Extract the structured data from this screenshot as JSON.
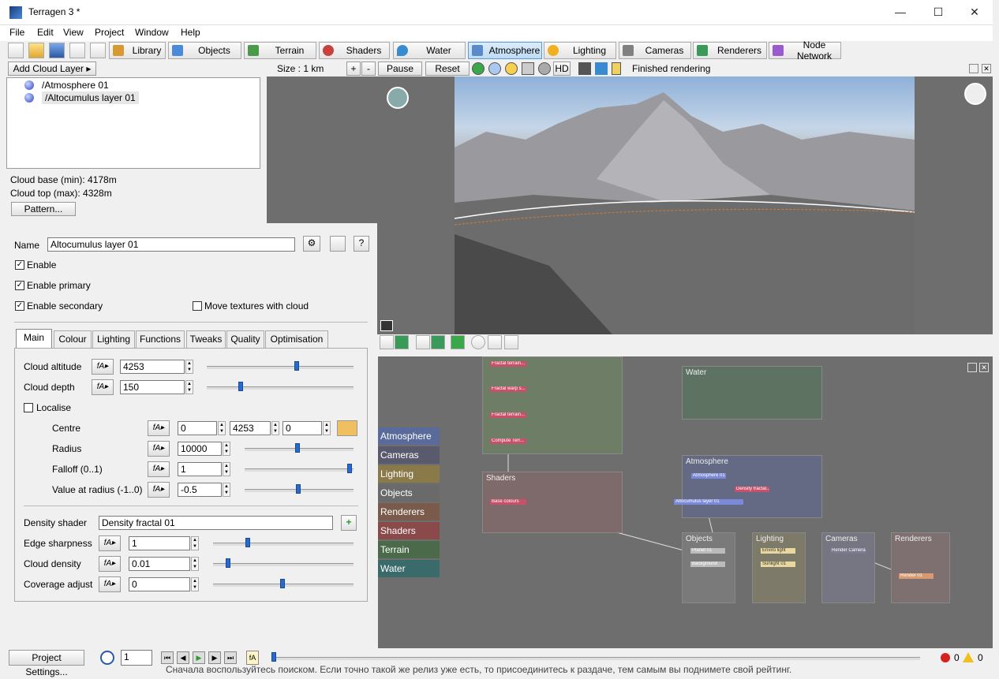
{
  "window": {
    "title": "Terragen 3 *",
    "minimize": "—",
    "maximize": "☐",
    "close": "✕"
  },
  "menu": [
    "File",
    "Edit",
    "View",
    "Project",
    "Window",
    "Help"
  ],
  "toolbar": {
    "tabs": [
      {
        "label": "Library",
        "color": "#d89a30"
      },
      {
        "label": "Objects",
        "color": "#4a8ad8"
      },
      {
        "label": "Terrain",
        "color": "#4a9a4a"
      },
      {
        "label": "Shaders",
        "color": "#c84040"
      },
      {
        "label": "Water",
        "color": "#3a8ad0"
      },
      {
        "label": "Atmosphere",
        "color": "#5a8ac8"
      },
      {
        "label": "Lighting",
        "color": "#f0b020"
      },
      {
        "label": "Cameras",
        "color": "#808080"
      },
      {
        "label": "Renderers",
        "color": "#3a9a5a"
      },
      {
        "label": "Node Network",
        "color": "#9a5ad0"
      }
    ]
  },
  "left_panel": {
    "add_cloud_layer": "Add Cloud Layer",
    "tree": [
      "/Atmosphere 01",
      "/Altocumulus layer 01"
    ],
    "cloud_base": "Cloud base (min): 4178m",
    "cloud_top": "Cloud top (max): 4328m",
    "pattern_button": "Pattern..."
  },
  "viewport_bar": {
    "size": "Size : 1 km",
    "plus": "+",
    "minus": "-",
    "pause": "Pause",
    "reset": "Reset",
    "hd": "HD",
    "status": "Finished rendering"
  },
  "props": {
    "name_label": "Name",
    "name_value": "Altocumulus layer 01",
    "help": "?",
    "enable": "Enable",
    "enable_primary": "Enable primary",
    "enable_secondary": "Enable secondary",
    "move_textures": "Move textures with cloud",
    "tabs": [
      "Main",
      "Colour",
      "Lighting",
      "Functions",
      "Tweaks",
      "Quality",
      "Optimisation"
    ],
    "cloud_altitude": {
      "label": "Cloud altitude",
      "value": "4253"
    },
    "cloud_depth": {
      "label": "Cloud depth",
      "value": "150"
    },
    "localise": "Localise",
    "centre": {
      "label": "Centre",
      "x": "0",
      "y": "4253",
      "z": "0"
    },
    "radius": {
      "label": "Radius",
      "value": "10000"
    },
    "falloff": {
      "label": "Falloff (0..1)",
      "value": "1"
    },
    "value_at_radius": {
      "label": "Value at radius (-1..0)",
      "value": "-0.5"
    },
    "density_shader": {
      "label": "Density shader",
      "value": "Density fractal 01"
    },
    "edge_sharpness": {
      "label": "Edge sharpness",
      "value": "1"
    },
    "cloud_density": {
      "label": "Cloud density",
      "value": "0.01"
    },
    "coverage_adjust": {
      "label": "Coverage adjust",
      "value": "0"
    }
  },
  "node_network": {
    "side_tabs": [
      {
        "label": "Atmosphere",
        "color": "#5a6a9a"
      },
      {
        "label": "Cameras",
        "color": "#5a5a6e"
      },
      {
        "label": "Lighting",
        "color": "#8a7a4a"
      },
      {
        "label": "Objects",
        "color": "#6a6a6a"
      },
      {
        "label": "Renderers",
        "color": "#7a5a4a"
      },
      {
        "label": "Shaders",
        "color": "#8a4a4a"
      },
      {
        "label": "Terrain",
        "color": "#4a6a4a"
      },
      {
        "label": "Water",
        "color": "#3a6a6a"
      }
    ],
    "groups": {
      "water": "Water",
      "shaders": "Shaders",
      "atmosphere": "Atmosphere",
      "objects": "Objects",
      "lighting": "Lighting",
      "cameras": "Cameras",
      "renderers": "Renderers"
    },
    "nodes": {
      "fractal_terrain_1": "Fractal terrain...",
      "fractal_warp": "Fractal warp s...",
      "fractal_terrain_2": "Fractal terrain...",
      "compute_terrain": "Compute Terr...",
      "base_colours": "Base colours",
      "atmosphere_01": "Atmosphere 01",
      "density_fractal": "Density fractal...",
      "altocumulus": "Altocumulus layer 01",
      "planet_01": "Planet 01",
      "background": "Background",
      "enviro_light": "Enviro light",
      "sunlight_01": "Sunlight 01",
      "render_camera": "Render Camera",
      "render_01": "Render 01"
    }
  },
  "status_bar": {
    "project_settings": "Project Settings...",
    "frame": "1",
    "errors": "0",
    "warnings": "0"
  },
  "bottom_text": "Сначала воспользуйтесь поиском. Если точно такой же релиз уже есть, то присоединитесь к раздаче, тем самым вы поднимете свой рейтинг."
}
